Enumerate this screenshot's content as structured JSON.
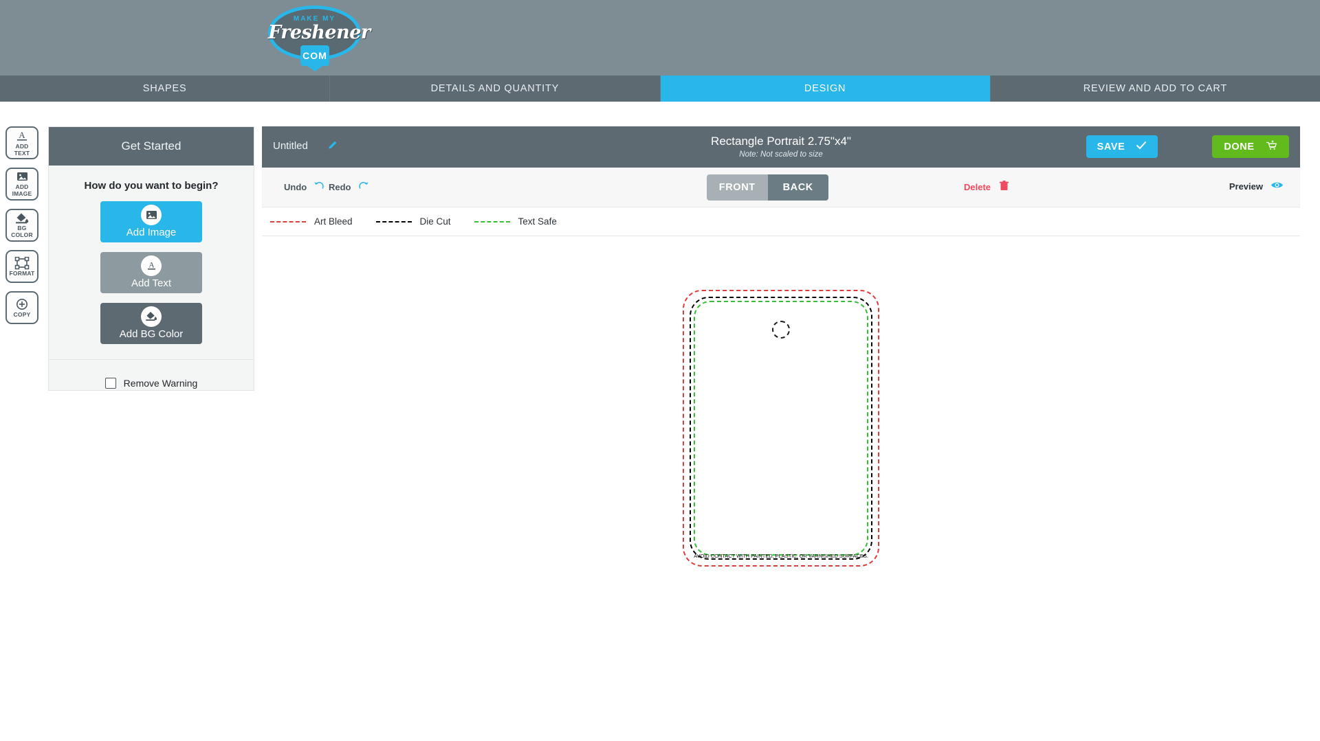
{
  "brand": {
    "logo_top": "MAKE MY",
    "logo_script": "Freshener",
    "logo_tag": "COM",
    "accent_cyan": "#29b6e8",
    "accent_green": "#62bb1d",
    "header_bg": "#7e8d93",
    "nav_bg": "#5d6a72"
  },
  "nav": {
    "tabs": [
      {
        "label": "SHAPES",
        "active": false
      },
      {
        "label": "DETAILS AND QUANTITY",
        "active": false
      },
      {
        "label": "DESIGN",
        "active": true
      },
      {
        "label": "REVIEW AND ADD TO CART",
        "active": false
      }
    ]
  },
  "rail": {
    "items": [
      {
        "icon": "add-text-icon",
        "line1": "ADD",
        "line2": "TEXT"
      },
      {
        "icon": "add-image-icon",
        "line1": "ADD",
        "line2": "IMAGE"
      },
      {
        "icon": "bg-color-icon",
        "line1": "BG",
        "line2": "COLOR"
      },
      {
        "icon": "format-icon",
        "line1": "FORMAT",
        "line2": ""
      },
      {
        "icon": "copy-icon",
        "line1": "COPY",
        "line2": ""
      }
    ]
  },
  "panel": {
    "header": "Get Started",
    "question": "How do you want to begin?",
    "options": [
      {
        "label": "Add Image",
        "icon": "image-icon",
        "color": "#29b6e8"
      },
      {
        "label": "Add Text",
        "icon": "text-a-icon",
        "color": "#8d9aa0"
      },
      {
        "label": "Add BG Color",
        "icon": "paint-bucket-icon",
        "color": "#5d6a72"
      }
    ],
    "remove_warning_label": "Remove Warning",
    "remove_warning_checked": false
  },
  "canvas": {
    "design_name": "Untitled",
    "edit_icon": "pencil-icon",
    "shape_title": "Rectangle Portrait 2.75\"x4\"",
    "shape_note": "Note: Not scaled to size",
    "save_label": "SAVE",
    "save_icon": "check-icon",
    "done_label": "DONE",
    "done_icon": "cart-icon"
  },
  "toolbar": {
    "undo_label": "Undo",
    "undo_icon": "undo-arrow-icon",
    "redo_label": "Redo",
    "redo_icon": "redo-arrow-icon",
    "side_front": "FRONT",
    "side_back": "BACK",
    "active_side": "BACK",
    "delete_label": "Delete",
    "delete_icon": "trash-icon",
    "preview_label": "Preview",
    "preview_icon": "eye-icon"
  },
  "legend": {
    "items": [
      {
        "label": "Art Bleed",
        "color": "#e03b3b"
      },
      {
        "label": "Die Cut",
        "color": "#000000"
      },
      {
        "label": "Text Safe",
        "color": "#35bf35"
      }
    ]
  },
  "artboard": {
    "warning_text": "AVOID CONTACT WITH PAINTED, PLASTIC, OR VARNISHED SURFACES.",
    "hole_name": "hanger-hole"
  }
}
